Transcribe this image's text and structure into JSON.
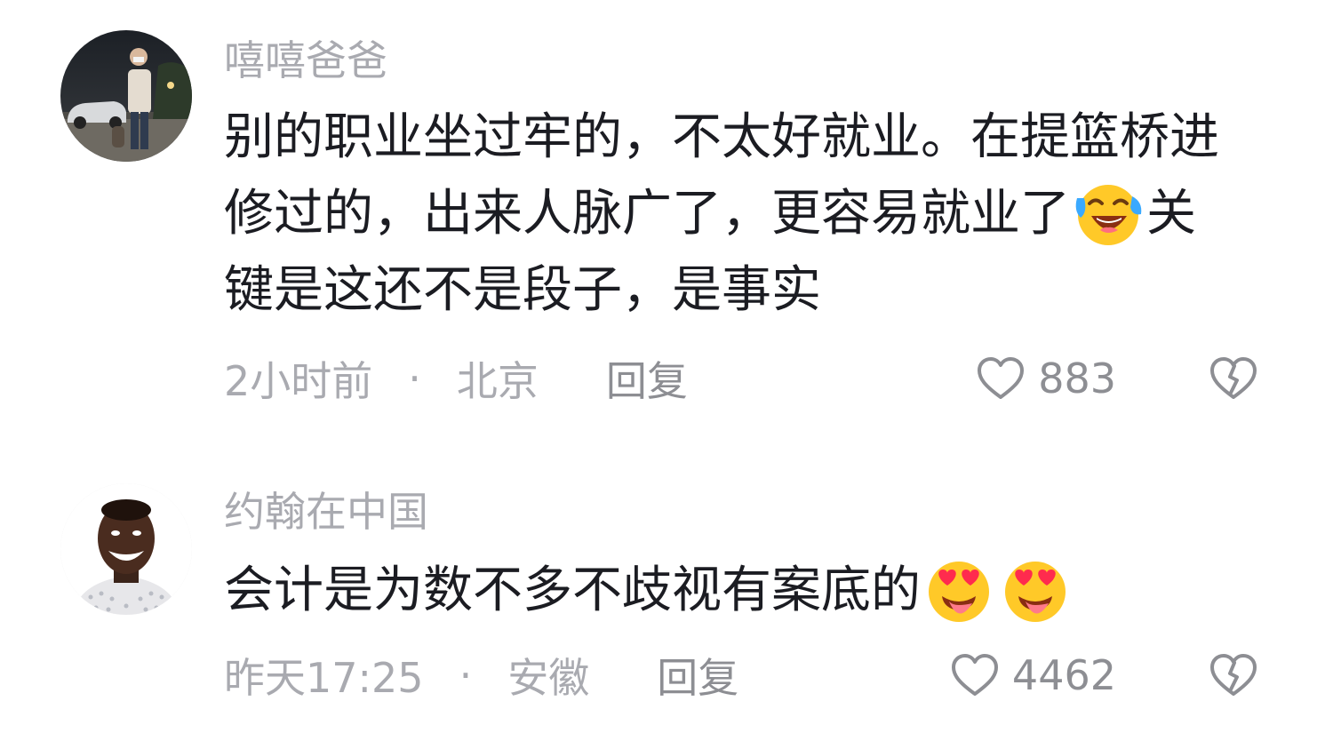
{
  "comments": [
    {
      "username": "嘻嘻爸爸",
      "text_part1": "别的职业坐过牢的，不太好就业。在提篮桥进修过的，出来人脉广了，更容易就业了",
      "emoji_1": "laughing-crying-emoji",
      "text_part2": "关键是这还不是段子，是事实",
      "time": "2小时前",
      "separator": "·",
      "location": "北京",
      "reply_label": "回复",
      "likes": "883"
    },
    {
      "username": "约翰在中国",
      "text_part1": "会计是为数不多不歧视有案底的",
      "emoji_1": "heart-eyes-tongue-emoji",
      "emoji_2": "heart-eyes-tongue-emoji",
      "time": "昨天17:25",
      "separator": "·",
      "location": "安徽",
      "reply_label": "回复",
      "likes": "4462"
    }
  ],
  "icons": {
    "like": "heart-outline-icon",
    "dislike": "broken-heart-icon"
  },
  "colors": {
    "secondary_text": "#a9aab0",
    "primary_text": "#1b1c22",
    "emoji_yellow": "#ffc928",
    "heart_red": "#ff2b4e"
  }
}
